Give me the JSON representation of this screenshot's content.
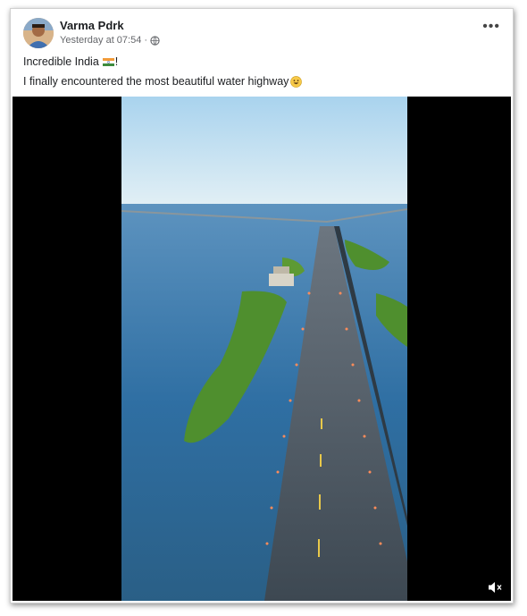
{
  "post": {
    "author": "Varma Pdrk",
    "timestamp": "Yesterday at 07:54",
    "separator": "·",
    "privacy_icon": "globe-icon",
    "menu_icon": "more-options-icon",
    "text_line1_prefix": "Incredible India ",
    "text_line1_suffix": "!",
    "text_line2": "I finally encountered the most beautiful water highway",
    "flag_icon": "india-flag-icon",
    "emoji_icon": "grinning-face-icon"
  },
  "video": {
    "mute_icon": "speaker-muted-icon"
  },
  "colors": {
    "author_text": "#1c1e21",
    "meta_text": "#65676b",
    "sky_top": "#b9dcef",
    "water": "#2f6fa3",
    "road": "#4a5560",
    "island": "#4f8f2e"
  }
}
